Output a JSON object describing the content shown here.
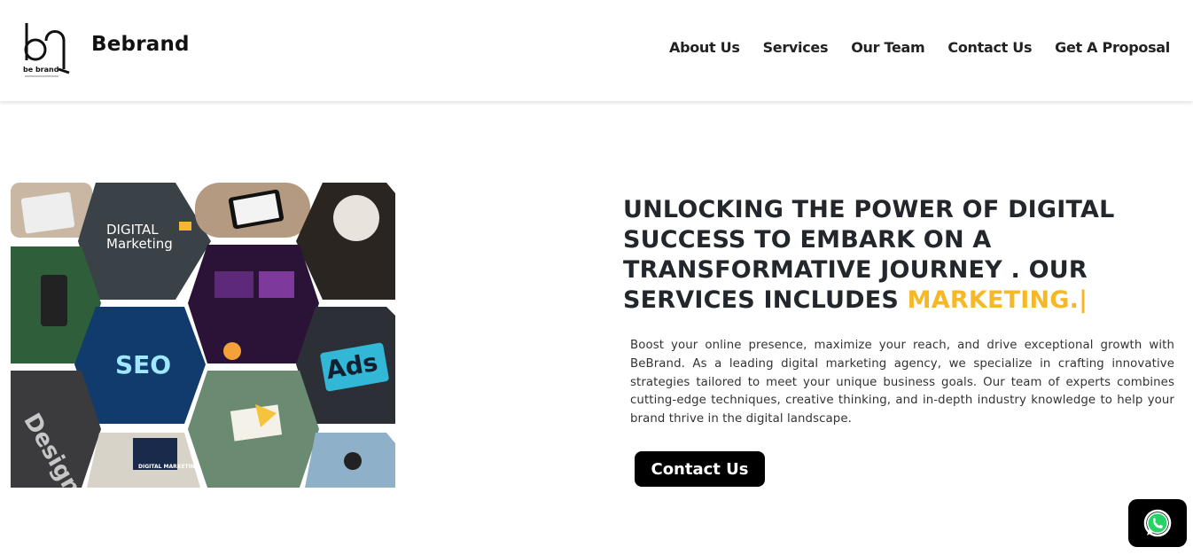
{
  "header": {
    "logo_text": "be brand",
    "brand_name": "Bebrand",
    "nav": [
      {
        "label": "About Us"
      },
      {
        "label": "Services"
      },
      {
        "label": "Our Team"
      },
      {
        "label": "Contact Us"
      },
      {
        "label": "Get A Proposal"
      }
    ]
  },
  "collage": {
    "tiles": [
      {
        "label": "DIGITAL"
      },
      {
        "label": "Marketing"
      },
      {
        "label": "SEO"
      },
      {
        "label": "Ads"
      },
      {
        "label": "Design"
      },
      {
        "label": "DIGITAL MARKETING"
      }
    ]
  },
  "hero": {
    "headline": "UNLOCKING THE POWER OF DIGITAL SUCCESS TO EMBARK ON A TRANSFORMATIVE JOURNEY . OUR SERVICES INCLUDES",
    "headline_accent": "MARKETING.",
    "cursor": "|",
    "description": "Boost your online presence, maximize your reach, and drive exceptional growth with BeBrand. As a leading digital marketing agency, we specialize in crafting innovative strategies tailored to meet your unique business goals. Our team of experts combines cutting-edge techniques, creative thinking, and in-depth industry knowledge to help your brand thrive in the digital landscape.",
    "cta_label": "Contact Us"
  },
  "colors": {
    "accent": "#f6b826",
    "button": "#000000",
    "text": "#23262b"
  },
  "icons": {
    "whatsapp": "whatsapp-icon"
  }
}
